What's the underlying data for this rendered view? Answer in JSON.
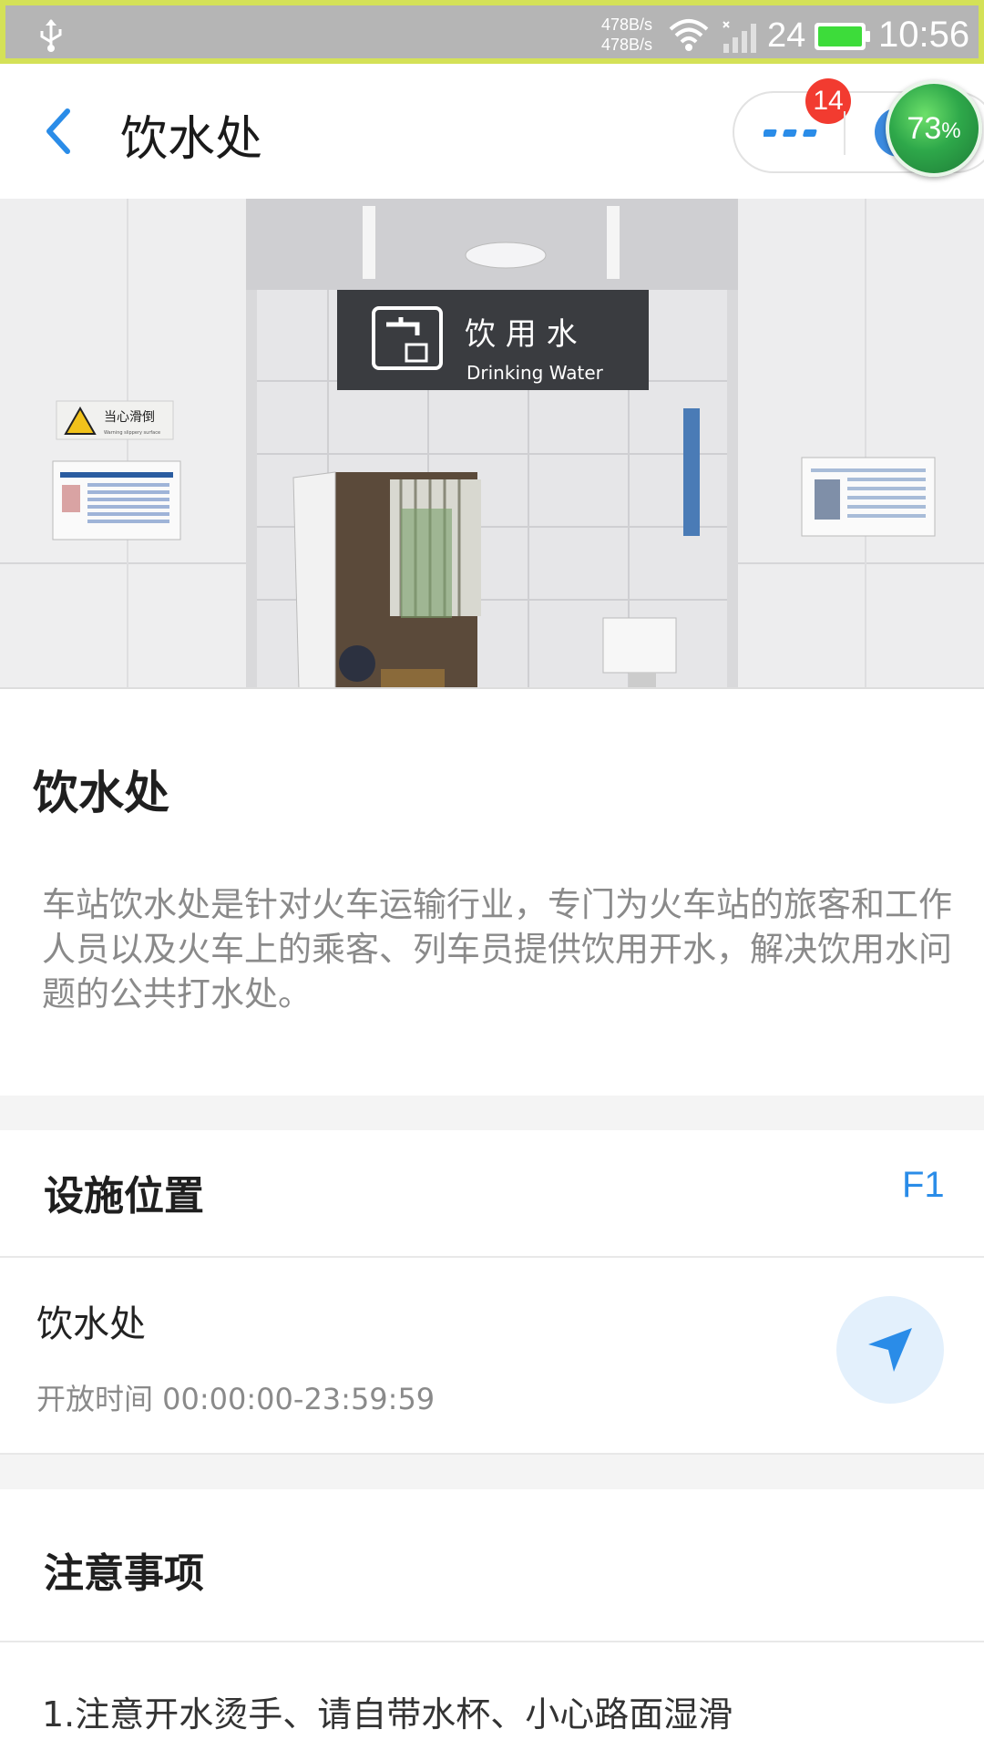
{
  "status_bar": {
    "net_speed_up": "478B/s",
    "net_speed_down": "478B/s",
    "signal_number": "24",
    "time": "10:56",
    "battery_color": "#3ddc3a"
  },
  "header": {
    "title": "饮水处",
    "badge_count": "14",
    "percent_value": "73",
    "percent_sign": "%"
  },
  "hero": {
    "sign_cn": "饮 用 水",
    "sign_en": "Drinking Water",
    "warning_sign": "当心滑倒",
    "warning_sign_en": "Warning slippery surface"
  },
  "intro": {
    "title": "饮水处",
    "description": "车站饮水处是针对火车运输行业，专门为火车站的旅客和工作人员以及火车上的乘客、列车员提供饮用开水，解决饮用水问题的公共打水处。"
  },
  "location": {
    "section_title": "设施位置",
    "floor": "F1",
    "name": "饮水处",
    "hours": "开放时间 00:00:00-23:59:59"
  },
  "notice": {
    "section_title": "注意事项",
    "text": "1.注意开水烫手、请自带水杯、小心路面湿滑"
  },
  "colors": {
    "accent": "#2a8ce8",
    "badge": "#f23b30"
  }
}
